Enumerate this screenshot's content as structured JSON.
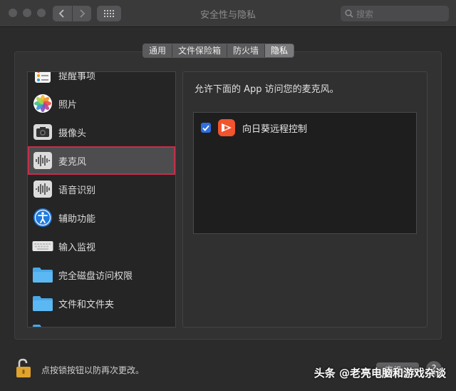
{
  "window": {
    "title": "安全性与隐私"
  },
  "search": {
    "placeholder": "搜索"
  },
  "tabs": [
    {
      "label": "通用",
      "active": false
    },
    {
      "label": "文件保险箱",
      "active": false
    },
    {
      "label": "防火墙",
      "active": false
    },
    {
      "label": "隐私",
      "active": true
    }
  ],
  "sidebar": {
    "items": [
      {
        "label": "提醒事项",
        "icon": "reminders-icon"
      },
      {
        "label": "照片",
        "icon": "photos-icon"
      },
      {
        "label": "摄像头",
        "icon": "camera-icon"
      },
      {
        "label": "麦克风",
        "icon": "microphone-icon",
        "selected": true
      },
      {
        "label": "语音识别",
        "icon": "speech-recognition-icon"
      },
      {
        "label": "辅助功能",
        "icon": "accessibility-icon"
      },
      {
        "label": "输入监视",
        "icon": "keyboard-icon"
      },
      {
        "label": "完全磁盘访问权限",
        "icon": "folder-icon"
      },
      {
        "label": "文件和文件夹",
        "icon": "folder-icon"
      }
    ]
  },
  "panel": {
    "caption": "允许下面的 App 访问您的麦克风。",
    "apps": [
      {
        "name": "向日葵远程控制",
        "checked": true,
        "icon": "sunlogin-icon"
      }
    ]
  },
  "footer": {
    "lock_text": "点按锁按钮以防再次更改。",
    "advanced_label": "高级…",
    "help_label": "?"
  },
  "watermark": "头条 @老亮电脑和游戏杂谈",
  "colors": {
    "accent": "#2f6de0",
    "selection_border": "#c0304a",
    "app_icon": "#f2542d"
  }
}
